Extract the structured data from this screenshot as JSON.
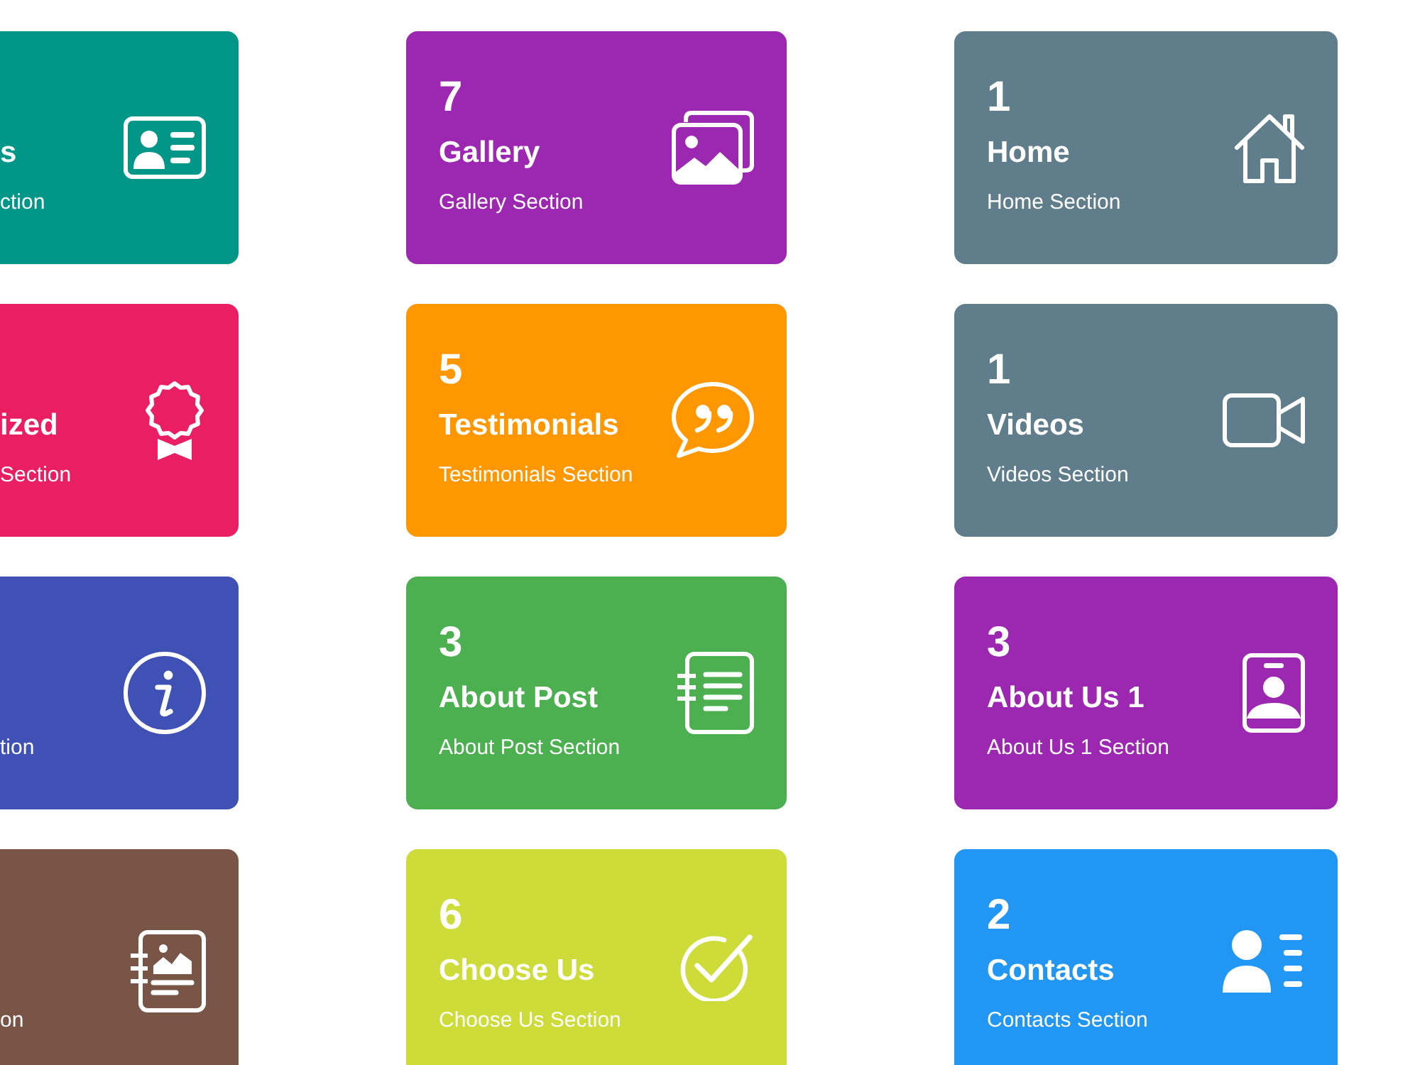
{
  "cards": [
    {
      "title": "s",
      "subtitle": "ction",
      "color": "#009688",
      "kind": "id-card"
    },
    {
      "count": "7",
      "title": "Gallery",
      "subtitle": "Gallery Section",
      "color": "#9c27b0",
      "kind": "gallery"
    },
    {
      "count": "1",
      "title": "Home",
      "subtitle": "Home Section",
      "color": "#607d8b",
      "kind": "home"
    },
    {
      "title": "ized",
      "subtitle": "Section",
      "color": "#e91e63",
      "kind": "award"
    },
    {
      "count": "5",
      "title": "Testimonials",
      "subtitle": "Testimonials Section",
      "color": "#ff9800",
      "kind": "quote"
    },
    {
      "count": "1",
      "title": "Videos",
      "subtitle": "Videos Section",
      "color": "#607d8b",
      "kind": "video"
    },
    {
      "subtitle": "tion",
      "color": "#3f51b5",
      "kind": "info"
    },
    {
      "count": "3",
      "title": "About Post",
      "subtitle": "About Post Section",
      "color": "#4caf50",
      "kind": "notebook"
    },
    {
      "count": "3",
      "title": "About Us 1",
      "subtitle": "About Us 1 Section",
      "color": "#9c27b0",
      "kind": "badge"
    },
    {
      "subtitle": "on",
      "color": "#795548",
      "kind": "notebook-chart"
    },
    {
      "count": "6",
      "title": "Choose Us",
      "subtitle": "Choose Us Section",
      "color": "#cddc39",
      "kind": "check"
    },
    {
      "count": "2",
      "title": "Contacts",
      "subtitle": "Contacts Section",
      "color": "#2196f3",
      "kind": "contacts"
    }
  ]
}
